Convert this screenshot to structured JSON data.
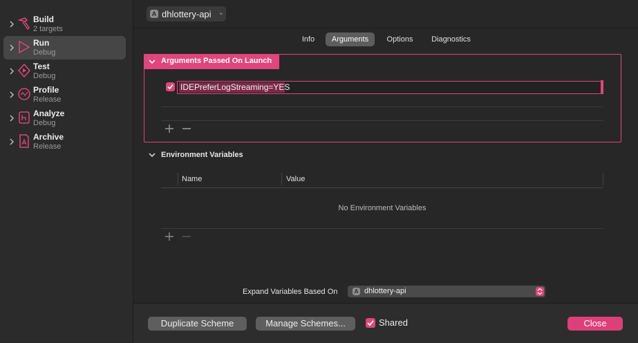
{
  "sidebar": {
    "items": [
      {
        "title": "Build",
        "subtitle": "2 targets",
        "icon": "hammer-icon"
      },
      {
        "title": "Run",
        "subtitle": "Debug",
        "icon": "play-icon",
        "selected": true
      },
      {
        "title": "Test",
        "subtitle": "Debug",
        "icon": "diamond-play-icon"
      },
      {
        "title": "Profile",
        "subtitle": "Release",
        "icon": "gauge-icon"
      },
      {
        "title": "Analyze",
        "subtitle": "Debug",
        "icon": "analyze-icon"
      },
      {
        "title": "Archive",
        "subtitle": "Release",
        "icon": "archive-icon"
      }
    ]
  },
  "header": {
    "scheme_name": "dhlottery-api",
    "app_icon_glyph": "A"
  },
  "tabs": [
    {
      "label": "Info"
    },
    {
      "label": "Arguments",
      "active": true
    },
    {
      "label": "Options"
    },
    {
      "label": "Diagnostics"
    }
  ],
  "arguments": {
    "section_title": "Arguments Passed On Launch",
    "items": [
      {
        "value": "IDEPreferLogStreaming=YES",
        "enabled": true
      }
    ]
  },
  "environment": {
    "section_title": "Environment Variables",
    "columns": [
      "Name",
      "Value"
    ],
    "empty_message": "No Environment Variables"
  },
  "expand": {
    "label": "Expand Variables Based On",
    "value": "dhlottery-api",
    "app_icon_glyph": "A"
  },
  "footer": {
    "duplicate_label": "Duplicate Scheme",
    "manage_label": "Manage Schemes...",
    "shared_label": "Shared",
    "shared_checked": true,
    "close_label": "Close"
  },
  "colors": {
    "accent": "#e0457b",
    "background": "#272727",
    "sidebar_selected": "#464646"
  }
}
